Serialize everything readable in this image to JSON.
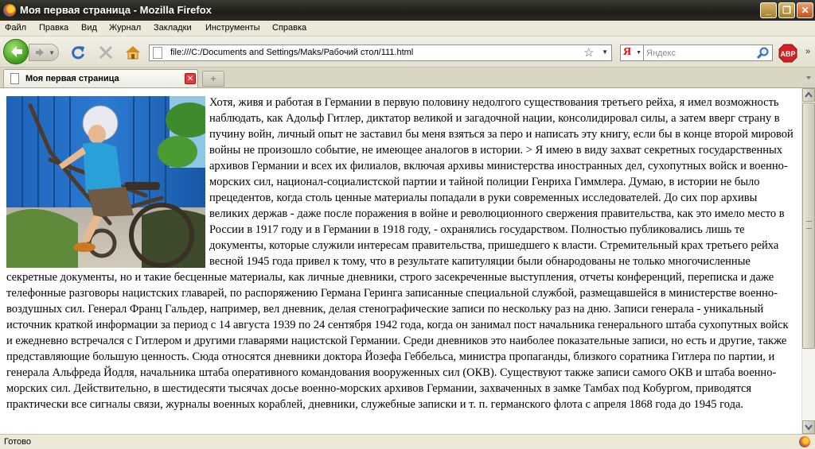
{
  "window": {
    "title": "Моя первая страница - Mozilla Firefox"
  },
  "menu": [
    "Файл",
    "Правка",
    "Вид",
    "Журнал",
    "Закладки",
    "Инструменты",
    "Справка"
  ],
  "navigation": {
    "url": "file:///C:/Documents and Settings/Maks/Рабочий стол/111.html",
    "search_engine": "Я",
    "search_placeholder": "Яндекс"
  },
  "tabs": [
    {
      "label": "Моя первая страница",
      "active": true
    }
  ],
  "content": {
    "article": "Хотя, живя и работая в Германии в первую половину недолгого существования третьего рейха, я имел возможность наблюдать, как Адольф Гитлер, диктатор великой и загадочной нации, консолидировал силы, а затем вверг страну в пучину войн, личный опыт не заставил бы меня взяться за перо и написать эту книгу, если бы в конце второй мировой войны не произошло событие, не имеющее аналогов в истории. > Я имею в виду захват секретных государственных архивов Германии и всех их филиалов, включая архивы министерства иностранных дел, сухопутных войск и военно-морских сил, национал-социалистской партии и тайной полиции Генриха Гиммлера. Думаю, в истории не было прецедентов, когда столь ценные материалы попадали в руки современных исследователей. До сих пор архивы великих держав - даже после поражения в войне и революционного свержения правительства, как это имело место в России в 1917 году и в Германии в 1918 году, - охранялись государством. Полностью публиковались лишь те документы, которые служили интересам правительства, пришедшего к власти. Стремительный крах третьего рейха весной 1945 года привел к тому, что в результате капитуляции были обнародованы не только многочисленные секретные документы, но и такие бесценные материалы, как личные дневники, строго засекреченные выступления, отчеты конференций, переписка и даже телефонные разговоры нацистских главарей, по распоряжению Германа Геринга записанные специальной службой, размещавшейся в министерстве военно-воздушных сил. Генерал Франц Гальдер, например, вел дневник, делая стенографические записи по нескольку раз на дню. Записи генерала - уникальный источник краткой информации за период с 14 августа 1939 по 24 сентября 1942 года, когда он занимал пост начальника генерального штаба сухопутных войск и ежедневно встречался с Гитлером и другими главарями нацистской Германии. Среди дневников это наиболее показательные записи, но есть и другие, также представляющие большую ценность. Сюда относятся дневники доктора Йозефа Геббельса, министра пропаганды, близкого соратника Гитлера по партии, и генерала Альфреда Йодля, начальника штаба оперативного командования вооруженных сил (ОКВ). Существуют также записи самого ОКВ и штаба военно-морских сил. Действительно, в шестидесяти тысячах досье военно-морских архивов Германии, захваченных в замке Тамбах под Кобургом, приводятся практически все сигналы связи, журналы военных кораблей, дневники, служебные записки и т. п. германского флота с апреля 1868 года до 1945 года."
  },
  "status": {
    "text": "Готово"
  },
  "colors": {
    "titlebar": "#2c2a22",
    "chrome": "#ece9d8",
    "back_button": "#3d9a1c",
    "tab_close": "#e23d3d"
  }
}
